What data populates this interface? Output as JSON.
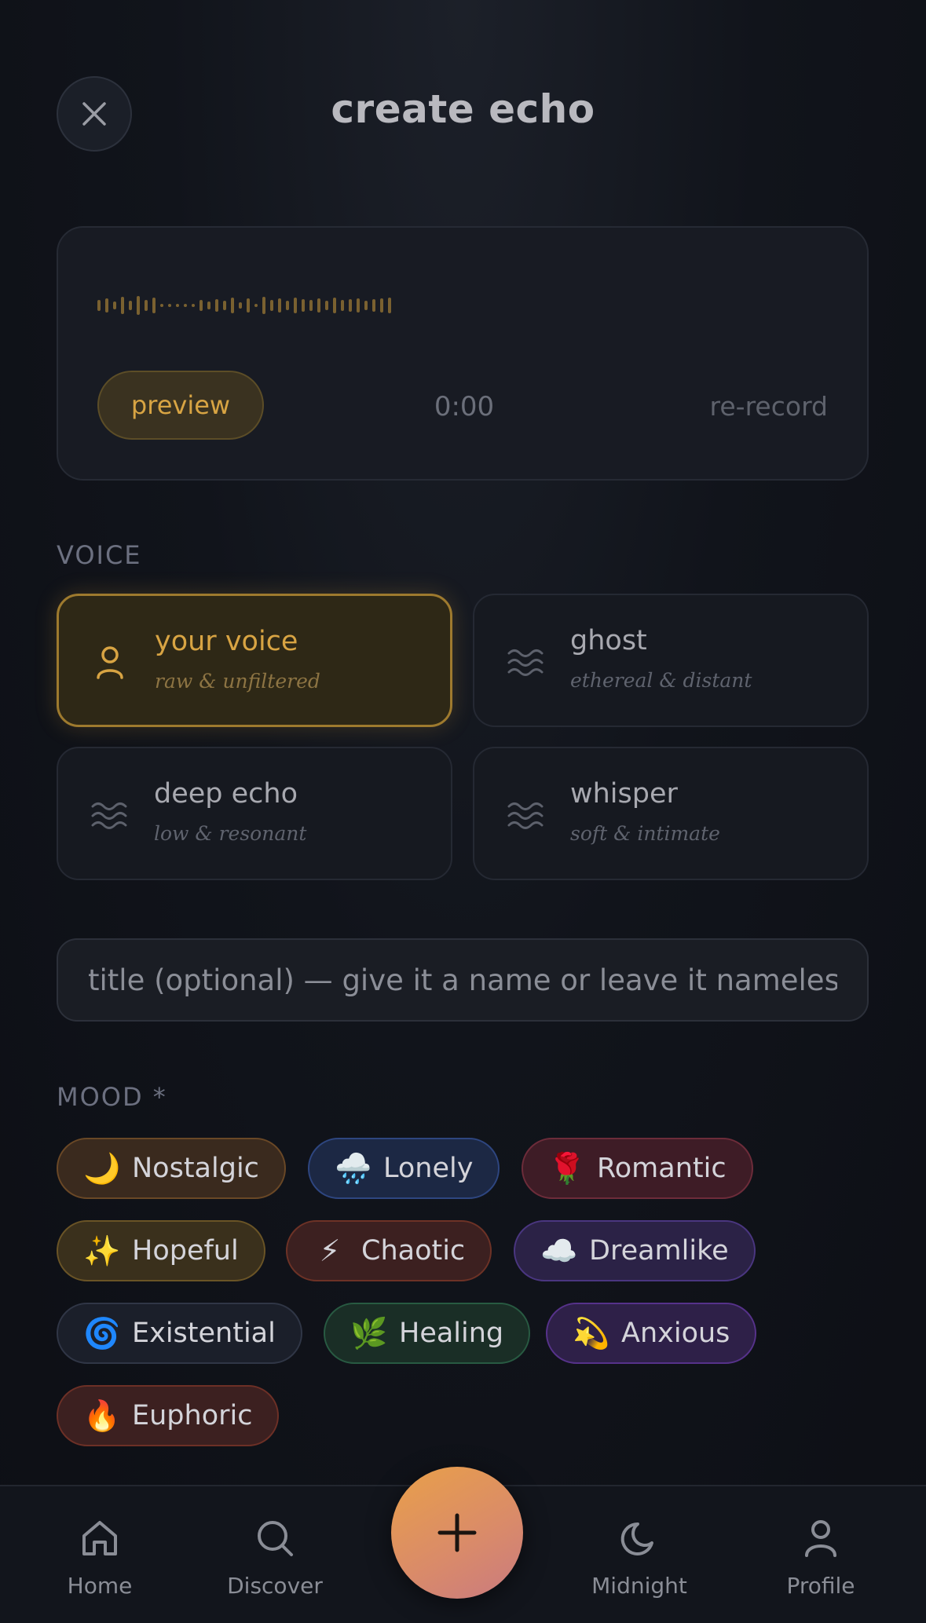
{
  "header": {
    "title": "create echo",
    "close_icon": "close-icon"
  },
  "recorder": {
    "preview_label": "preview",
    "timer": "0:00",
    "rerecord_label": "re-record",
    "accent_color": "#d8a443"
  },
  "voice": {
    "section_label": "VOICE",
    "options": [
      {
        "name": "your voice",
        "description": "raw & unfiltered",
        "icon": "person-icon",
        "selected": true
      },
      {
        "name": "ghost",
        "description": "ethereal & distant",
        "icon": "waves-icon",
        "selected": false
      },
      {
        "name": "deep echo",
        "description": "low & resonant",
        "icon": "waves-icon",
        "selected": false
      },
      {
        "name": "whisper",
        "description": "soft & intimate",
        "icon": "waves-icon",
        "selected": false
      }
    ]
  },
  "title_field": {
    "placeholder": "title (optional) — give it a name or leave it nameless",
    "value": ""
  },
  "mood": {
    "section_label": "MOOD *",
    "chips": [
      {
        "emoji": "🌙",
        "label": "Nostalgic"
      },
      {
        "emoji": "🌧️",
        "label": "Lonely"
      },
      {
        "emoji": "🌹",
        "label": "Romantic"
      },
      {
        "emoji": "✨",
        "label": "Hopeful"
      },
      {
        "emoji": "⚡",
        "label": "Chaotic"
      },
      {
        "emoji": "☁️",
        "label": "Dreamlike"
      },
      {
        "emoji": "🌀",
        "label": "Existential"
      },
      {
        "emoji": "🌿",
        "label": "Healing"
      },
      {
        "emoji": "💫",
        "label": "Anxious"
      },
      {
        "emoji": "🔥",
        "label": "Euphoric"
      }
    ]
  },
  "nav": {
    "items": [
      {
        "label": "Home",
        "icon": "home-icon"
      },
      {
        "label": "Discover",
        "icon": "search-icon"
      },
      {
        "label": "Midnight",
        "icon": "moon-icon"
      },
      {
        "label": "Profile",
        "icon": "person-icon"
      }
    ],
    "fab_icon": "plus-icon"
  }
}
